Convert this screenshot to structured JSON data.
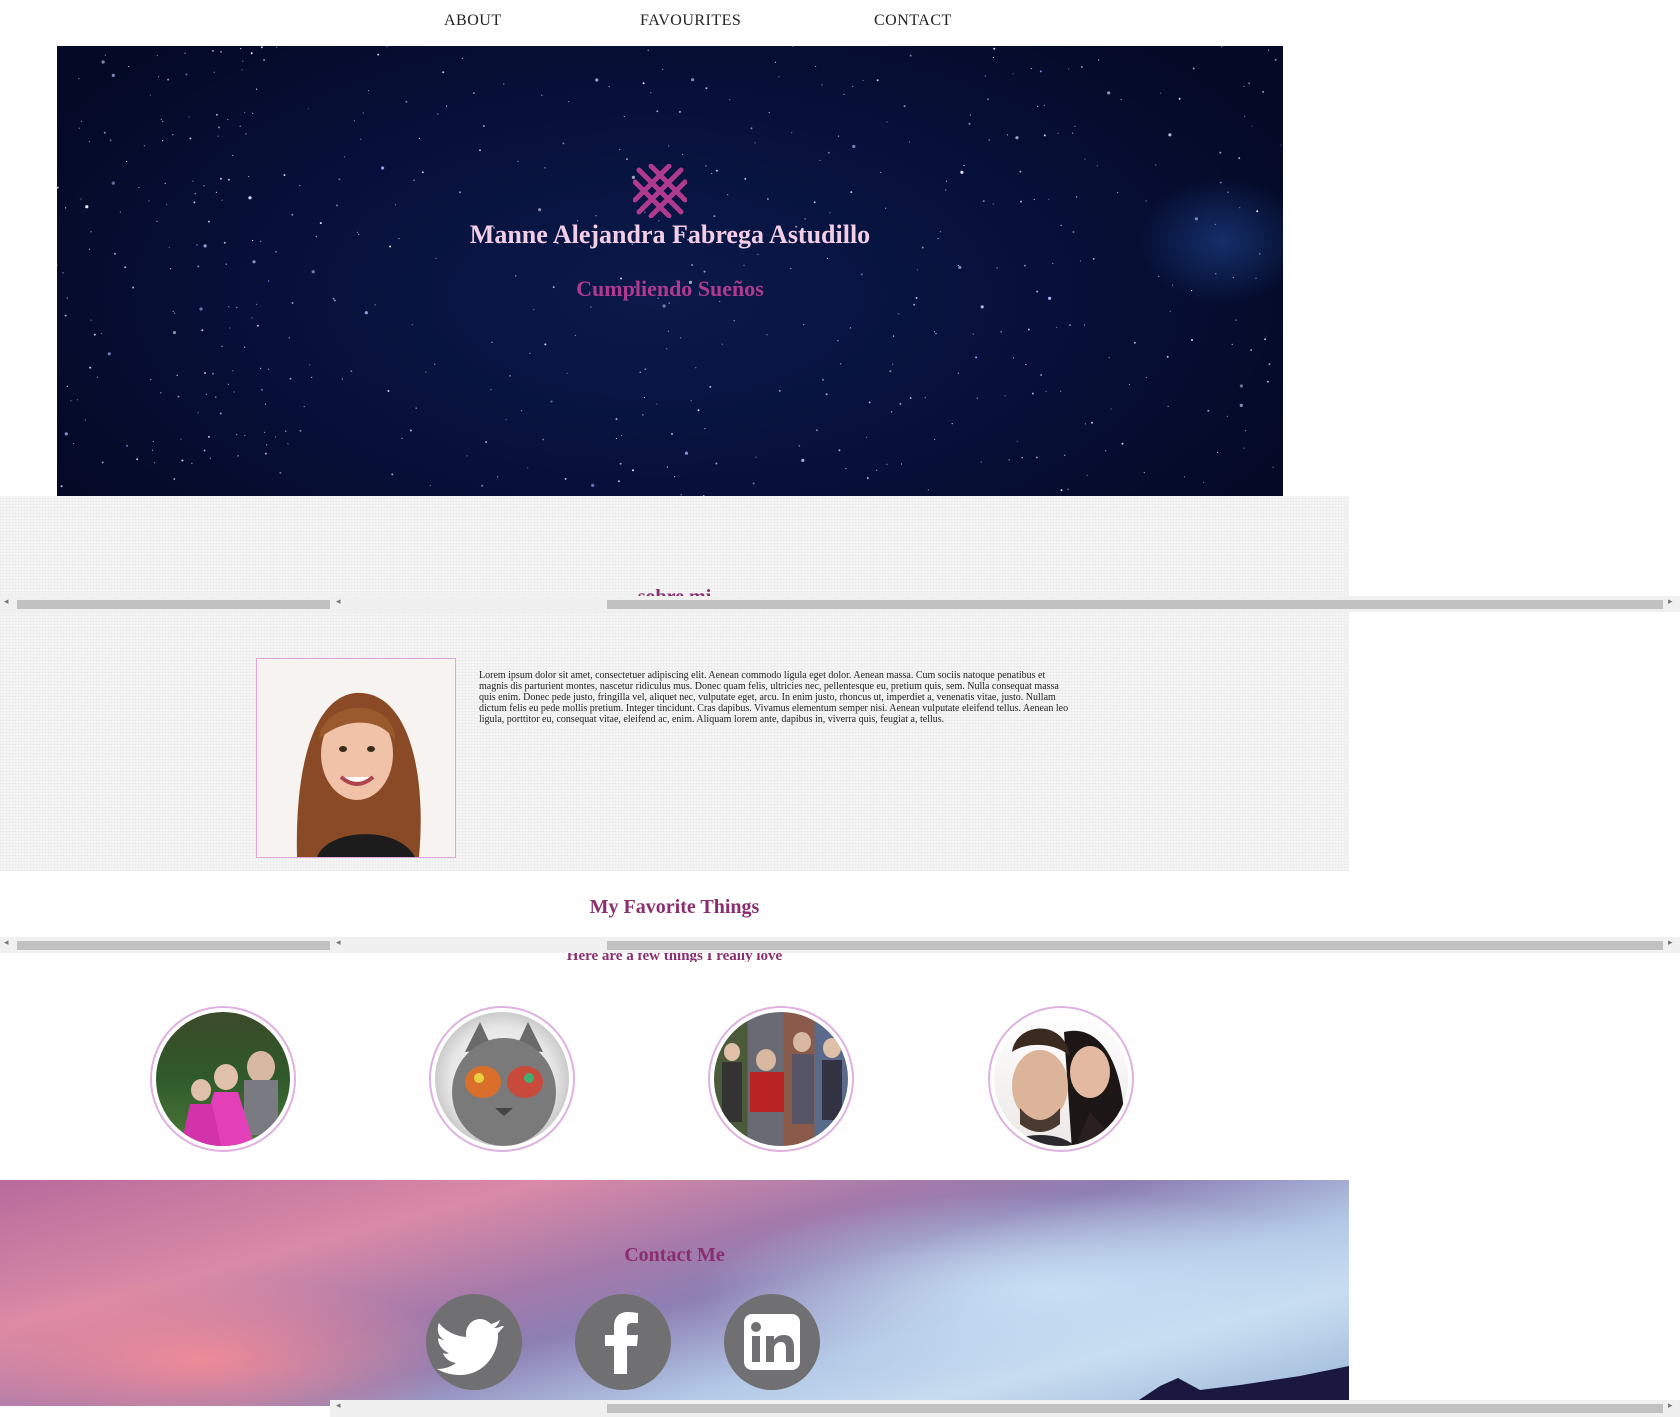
{
  "nav": {
    "items": [
      {
        "label": "ABOUT"
      },
      {
        "label": "FAVOURITES"
      },
      {
        "label": "CONTACT"
      }
    ]
  },
  "hero": {
    "logo_icon": "hashtag-cross-icon",
    "title": "Manne Alejandra Fabrega Astudillo",
    "subtitle": "Cumpliendo Sueños"
  },
  "about": {
    "heading_partial": "sobre mi",
    "portrait_icon": "portrait-photo",
    "text": "Lorem ipsum dolor sit amet, consectetuer adipiscing elit. Aenean commodo ligula eget dolor. Aenean massa. Cum sociis natoque penatibus et magnis dis parturient montes, nascetur ridiculus mus. Donec quam felis, ultricies nec, pellentesque eu, pretium quis, sem. Nulla consequat massa quis enim. Donec pede justo, fringilla vel, aliquet nec, vulputate eget, arcu. In enim justo, rhoncus ut, imperdiet a, venenatis vitae, justo. Nullam dictum felis eu pede mollis pretium. Integer tincidunt. Cras dapibus. Vivamus elementum semper nisi. Aenean vulputate eleifend tellus. Aenean leo ligula, porttitor eu, consequat vitae, eleifend ac, enim. Aliquam lorem ante, dapibus in, viverra quis, feugiat a, tellus."
  },
  "favorites": {
    "heading": "My Favorite Things",
    "subheading": "Here are a few things I really love",
    "items": [
      {
        "icon": "children-photo"
      },
      {
        "icon": "cat-with-glasses-photo"
      },
      {
        "icon": "family-collage-photo"
      },
      {
        "icon": "couple-photo"
      }
    ]
  },
  "contact": {
    "heading": "Contact Me",
    "socials": [
      {
        "icon": "twitter-icon"
      },
      {
        "icon": "facebook-icon"
      },
      {
        "icon": "linkedin-icon"
      }
    ]
  },
  "colors": {
    "accent": "#8a2e6e",
    "hero_title": "#f3cde6",
    "hero_subtitle": "#b03a8e",
    "social_gray": "#707072",
    "frame_border": "#e1a6dc"
  }
}
